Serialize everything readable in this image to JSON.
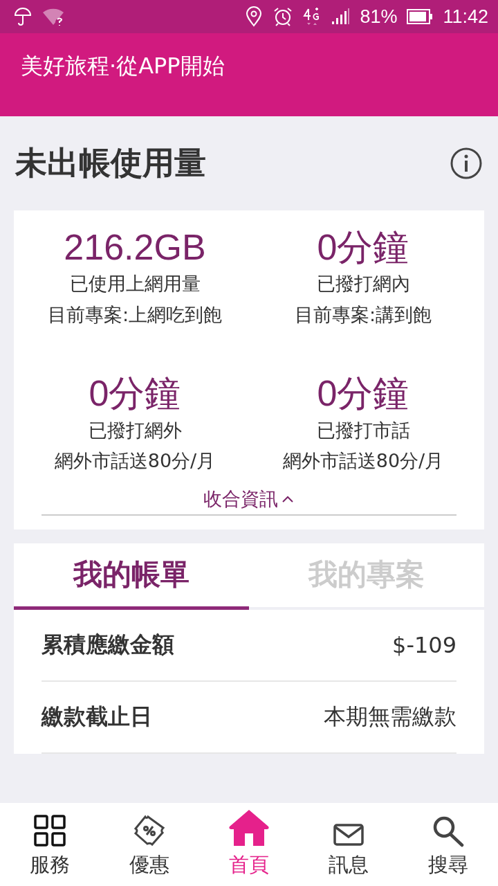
{
  "status_bar": {
    "battery": "81%",
    "time": "11:42"
  },
  "header": {
    "title": "美好旅程·從APP開始"
  },
  "usage": {
    "title": "未出帳使用量",
    "stats": [
      {
        "value": "216.2GB",
        "label": "已使用上網用量",
        "plan": "目前專案:上網吃到飽"
      },
      {
        "value": "0分鐘",
        "label": "已撥打網內",
        "plan": "目前專案:講到飽"
      },
      {
        "value": "0分鐘",
        "label": "已撥打網外",
        "plan": "網外市話送80分/月"
      },
      {
        "value": "0分鐘",
        "label": "已撥打市話",
        "plan": "網外市話送80分/月"
      }
    ],
    "collapse_link": "收合資訊"
  },
  "tabs": [
    {
      "label": "我的帳單",
      "selected": true
    },
    {
      "label": "我的專案",
      "selected": false
    }
  ],
  "bill_rows": [
    {
      "label": "累積應繳金額",
      "value": "$-109"
    },
    {
      "label": "繳款截止日",
      "value": "本期無需繳款"
    }
  ],
  "bottom_nav": [
    {
      "kind": "grid",
      "label": "服務",
      "selected": false
    },
    {
      "kind": "coupon",
      "label": "優惠",
      "selected": false
    },
    {
      "kind": "home",
      "label": "首頁",
      "selected": true
    },
    {
      "kind": "mail",
      "label": "訊息",
      "selected": false
    },
    {
      "kind": "search",
      "label": "搜尋",
      "selected": false
    }
  ]
}
